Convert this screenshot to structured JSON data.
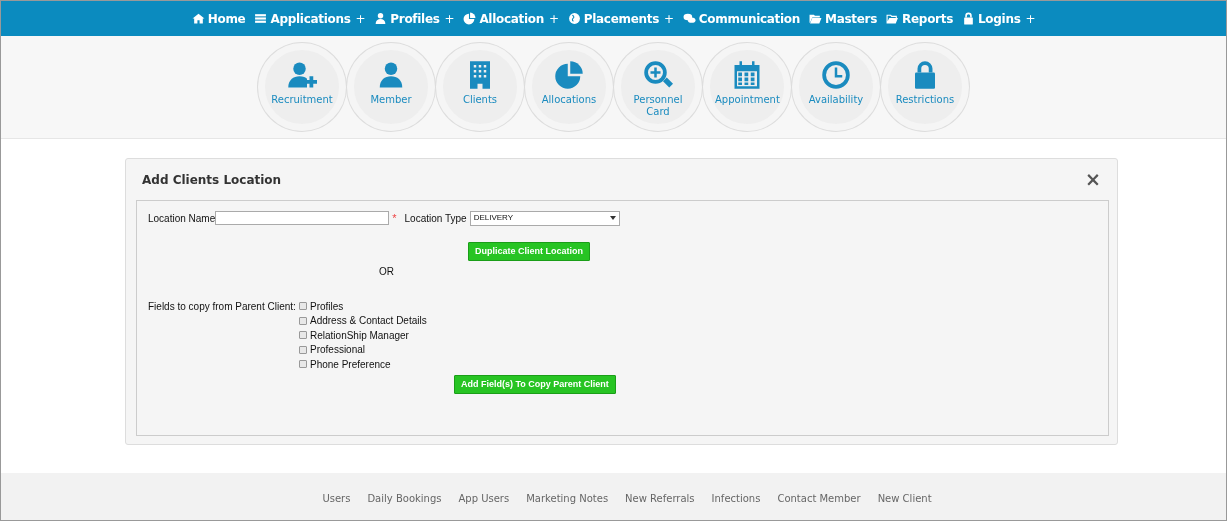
{
  "nav": [
    {
      "label": "Home"
    },
    {
      "label": "Applications",
      "expand_mark": "+"
    },
    {
      "label": "Profiles",
      "expand_mark": "+"
    },
    {
      "label": "Allocation",
      "expand_mark": "+"
    },
    {
      "label": "Placements",
      "expand_mark": "+"
    },
    {
      "label": "Communication"
    },
    {
      "label": "Masters"
    },
    {
      "label": "Reports"
    },
    {
      "label": "Logins",
      "expand_mark": "+"
    }
  ],
  "shortcuts": [
    {
      "label": "Recruitment"
    },
    {
      "label": "Member"
    },
    {
      "label": "Clients"
    },
    {
      "label": "Allocations"
    },
    {
      "label": "Personnel Card"
    },
    {
      "label": "Appointment"
    },
    {
      "label": "Availability"
    },
    {
      "label": "Restrictions"
    }
  ],
  "panel": {
    "title": "Add Clients Location",
    "close": "×",
    "location_name": {
      "label": "Location Name",
      "required_mark": "*"
    },
    "location_type": {
      "label": "Location Type",
      "value": "DELIVERY"
    },
    "duplicate_button": "Duplicate Client Location",
    "separator": "OR",
    "copy_label": "Fields to copy from Parent Client:",
    "copy_fields": [
      {
        "label": "Profiles",
        "checked": false
      },
      {
        "label": "Address & Contact Details",
        "checked": false
      },
      {
        "label": "RelationShip Manager",
        "checked": false
      },
      {
        "label": "Professional",
        "checked": false
      },
      {
        "label": "Phone Preference",
        "checked": false
      }
    ],
    "copy_button": "Add Field(s) To Copy Parent Client"
  },
  "footer_links": [
    "Users",
    "Daily Bookings",
    "App Users",
    "Marketing Notes",
    "New Referrals",
    "Infections",
    "Contact Member",
    "New Client"
  ]
}
